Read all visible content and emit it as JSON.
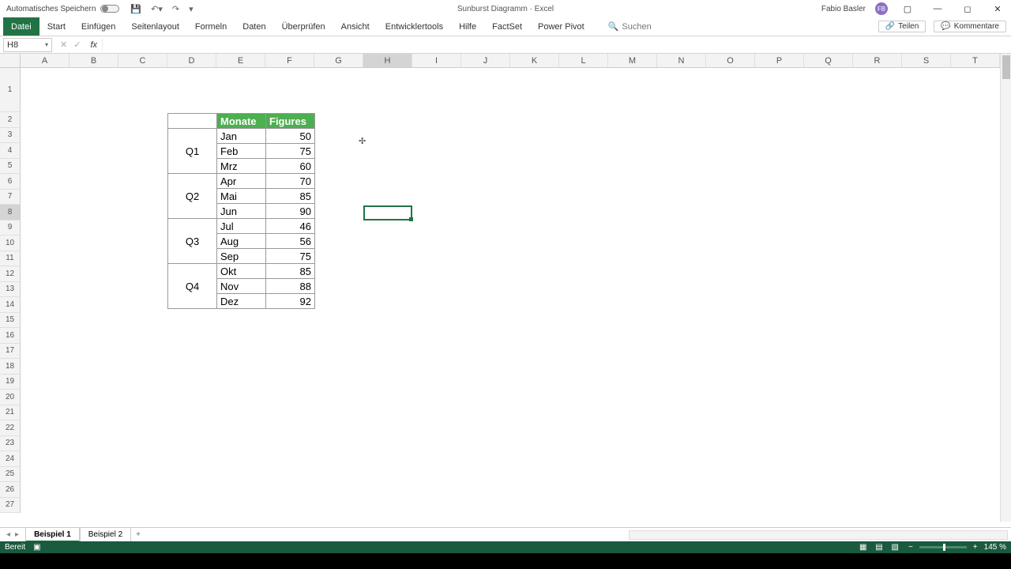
{
  "titlebar": {
    "autosave_label": "Automatisches Speichern",
    "document_title": "Sunburst Diagramm · Excel",
    "user_name": "Fabio Basler",
    "user_initials": "FB"
  },
  "ribbon": {
    "tabs": [
      "Datei",
      "Start",
      "Einfügen",
      "Seitenlayout",
      "Formeln",
      "Daten",
      "Überprüfen",
      "Ansicht",
      "Entwicklertools",
      "Hilfe",
      "FactSet",
      "Power Pivot"
    ],
    "active_tab": 0,
    "search_placeholder": "Suchen",
    "share_label": "Teilen",
    "comments_label": "Kommentare"
  },
  "formula": {
    "namebox": "H8",
    "fx_label": "fx"
  },
  "columns": [
    "A",
    "B",
    "C",
    "D",
    "E",
    "F",
    "G",
    "H",
    "I",
    "J",
    "K",
    "L",
    "M",
    "N",
    "O",
    "P",
    "Q",
    "R",
    "S",
    "T"
  ],
  "selected_col_index": 7,
  "rows_count": 27,
  "selected_row": 8,
  "table": {
    "headers": [
      "Monate",
      "Figures"
    ],
    "quarters": [
      {
        "label": "Q1",
        "months": [
          {
            "m": "Jan",
            "v": 50
          },
          {
            "m": "Feb",
            "v": 75
          },
          {
            "m": "Mrz",
            "v": 60
          }
        ]
      },
      {
        "label": "Q2",
        "months": [
          {
            "m": "Apr",
            "v": 70
          },
          {
            "m": "Mai",
            "v": 85
          },
          {
            "m": "Jun",
            "v": 90
          }
        ]
      },
      {
        "label": "Q3",
        "months": [
          {
            "m": "Jul",
            "v": 46
          },
          {
            "m": "Aug",
            "v": 56
          },
          {
            "m": "Sep",
            "v": 75
          }
        ]
      },
      {
        "label": "Q4",
        "months": [
          {
            "m": "Okt",
            "v": 85
          },
          {
            "m": "Nov",
            "v": 88
          },
          {
            "m": "Dez",
            "v": 92
          }
        ]
      }
    ]
  },
  "sheets": {
    "tabs": [
      "Beispiel 1",
      "Beispiel 2"
    ],
    "active": 0,
    "add_label": "+"
  },
  "statusbar": {
    "ready": "Bereit",
    "zoom": "145 %"
  }
}
